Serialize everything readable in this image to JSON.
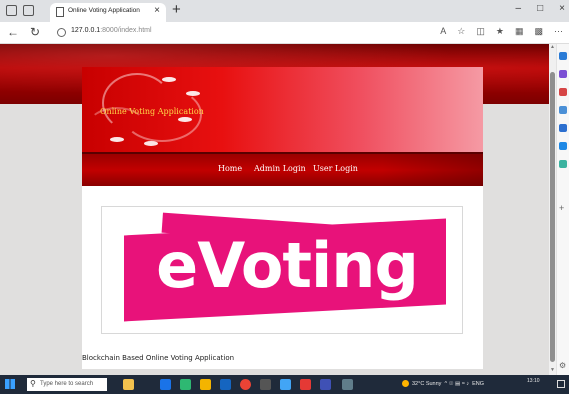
{
  "browser": {
    "tab_title": "Online Voting Application",
    "tab_close": "×",
    "new_tab": "+",
    "url_host": "127.0.0.1",
    "url_path": ":8000/index.html",
    "window_controls": [
      "–",
      "□",
      "×"
    ]
  },
  "page": {
    "site_title": "Online Voting Application",
    "nav": [
      "Home",
      "Admin Login",
      "User Login"
    ],
    "logo_text": "eVoting",
    "footer": "Blockchain Based Online Voting Application"
  },
  "taskbar": {
    "search_placeholder": "Type here to search",
    "weather": "32°C Sunny",
    "language": "ENG",
    "time": "13:10"
  },
  "colors": {
    "header_red": "#c80000",
    "logo_pink": "#e8127a",
    "title_gold": "#ffd84a"
  }
}
